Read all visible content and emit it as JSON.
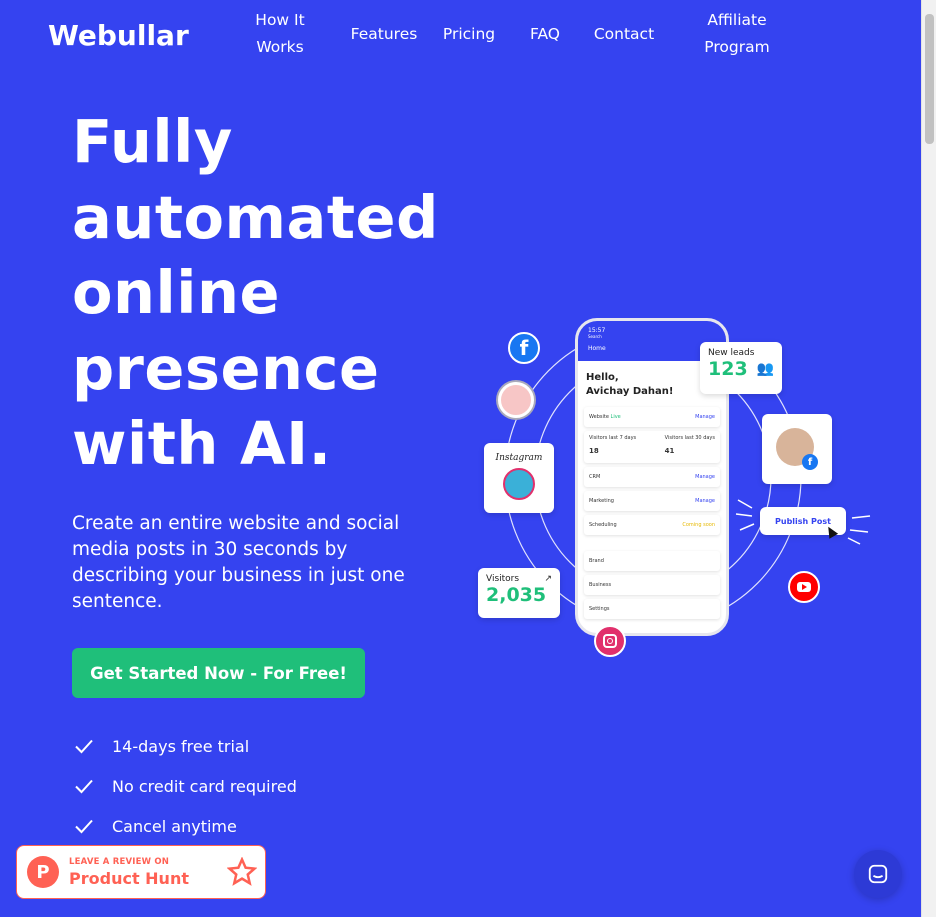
{
  "nav": {
    "logo": "Webullar",
    "items": [
      {
        "label": "How It Works"
      },
      {
        "label": "Features"
      },
      {
        "label": "Pricing"
      },
      {
        "label": "FAQ"
      },
      {
        "label": "Contact"
      },
      {
        "label": "Affiliate Program"
      }
    ]
  },
  "hero": {
    "headline_lines": [
      "Fully",
      "automated",
      "online",
      "presence",
      "with AI."
    ],
    "subtitle": "Create an entire website and social media posts in 30 seconds by describing your business in just one sentence.",
    "cta_label": "Get Started Now - For Free!",
    "checks": [
      "14-days free trial",
      "No credit card required",
      "Cancel anytime"
    ]
  },
  "illustration": {
    "phone": {
      "time": "15:57",
      "back": "Search",
      "title": "Home",
      "greeting": "Hello,",
      "name": "Avichay Dahan!",
      "website_label": "Website",
      "live_badge": "Live",
      "manage": "Manage",
      "visitors_7": "Visitors last 7 days",
      "visitors_7_value": "18",
      "visitors_30": "Visitors last 30 days",
      "visitors_30_value": "41",
      "crm": "CRM",
      "marketing": "Marketing",
      "scheduling": "Scheduling",
      "coming_soon": "Coming soon",
      "brand": "Brand",
      "business": "Business",
      "settings": "Settings"
    },
    "new_leads_label": "New leads",
    "new_leads_value": "123",
    "visitors_label": "Visitors",
    "visitors_value": "2,035",
    "instagram_label": "Instagram",
    "publish_label": "Publish Post",
    "colors": {
      "facebook": "#1877f2",
      "youtube": "#ff0000",
      "instagram": "#e1306c",
      "accent_green": "#1fbf7a"
    }
  },
  "product_hunt": {
    "small": "LEAVE A REVIEW ON",
    "big": "Product Hunt"
  },
  "colors": {
    "background": "#3543f0",
    "cta": "#1fbf7a",
    "product_hunt": "#ff6154"
  }
}
